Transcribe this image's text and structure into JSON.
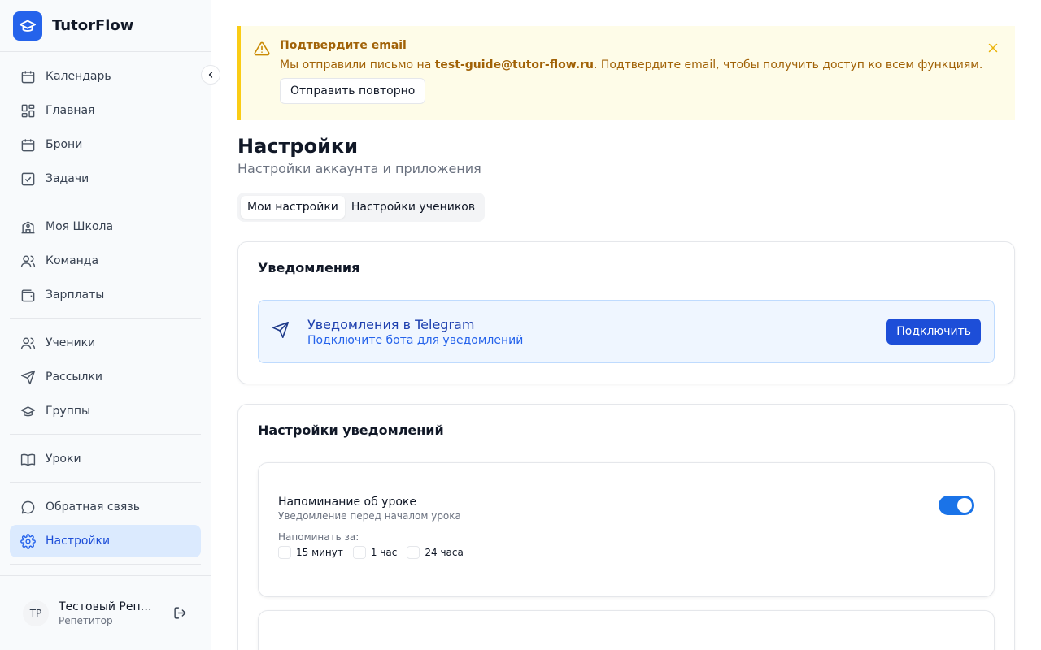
{
  "app": {
    "name": "TutorFlow"
  },
  "sidebar": {
    "groups": [
      [
        {
          "label": "Календарь",
          "icon": "calendar-icon"
        },
        {
          "label": "Главная",
          "icon": "dashboard-icon"
        },
        {
          "label": "Брони",
          "icon": "calendar-icon"
        },
        {
          "label": "Задачи",
          "icon": "checkbox-icon"
        }
      ],
      [
        {
          "label": "Моя Школа",
          "icon": "school-icon"
        },
        {
          "label": "Команда",
          "icon": "users-icon"
        },
        {
          "label": "Зарплаты",
          "icon": "wallet-icon"
        }
      ],
      [
        {
          "label": "Ученики",
          "icon": "users-icon"
        },
        {
          "label": "Рассылки",
          "icon": "send-icon"
        },
        {
          "label": "Группы",
          "icon": "graduation-cap-icon"
        }
      ],
      [
        {
          "label": "Уроки",
          "icon": "book-icon"
        }
      ],
      [
        {
          "label": "Обратная связь",
          "icon": "message-icon"
        },
        {
          "label": "Настройки",
          "icon": "gear-icon",
          "active": true
        }
      ]
    ],
    "user": {
      "initials": "ТР",
      "name": "Тестовый Репетитор",
      "role": "Репетитор"
    }
  },
  "alert": {
    "title": "Подтвердите email",
    "text_before": "Мы отправили письмо на ",
    "email": "test-guide@tutor-flow.ru",
    "text_after": ". Подтвердите email, чтобы получить доступ ко всем функциям.",
    "button": "Отправить повторно"
  },
  "page": {
    "title": "Настройки",
    "subtitle": "Настройки аккаунта и приложения",
    "tabs": [
      {
        "label": "Мои настройки",
        "active": true
      },
      {
        "label": "Настройки учеников"
      }
    ]
  },
  "notifications": {
    "title": "Уведомления",
    "telegram": {
      "title": "Уведомления в Telegram",
      "subtitle": "Подключите бота для уведомлений",
      "button": "Подключить"
    }
  },
  "notification_settings": {
    "title": "Настройки уведомлений",
    "lesson_reminder": {
      "title": "Напоминание об уроке",
      "subtitle": "Уведомление перед началом урока",
      "enabled": true,
      "remind_label": "Напоминать за:",
      "options": [
        "15 минут",
        "1 час",
        "24 часа"
      ]
    }
  },
  "colors": {
    "accent": "#2563eb",
    "active_bg": "#dbeafe",
    "alert_bg": "#fefce8",
    "alert_border": "#facc15",
    "toggle_on": "#1a73e8"
  }
}
